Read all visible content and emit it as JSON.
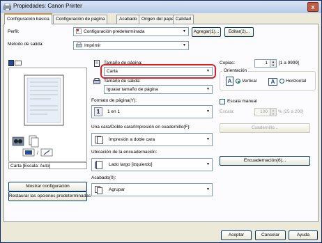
{
  "window": {
    "title": "Propiedades: Canon Printer",
    "close_glyph": "x"
  },
  "tabs": [
    {
      "label": "Configuración básica"
    },
    {
      "label": "Configuración de página"
    },
    {
      "label": "Acabado"
    },
    {
      "label": "Origen del papel"
    },
    {
      "label": "Calidad"
    }
  ],
  "profile": {
    "label": "Perfil:",
    "value": "Configuración predeterminada",
    "add_button": "Agregar(1)...",
    "edit_button": "Editar(2)..."
  },
  "output": {
    "label": "Método de salida:",
    "value": "Imprimir"
  },
  "page_size": {
    "label": "Tamaño de página:",
    "value": "Carta"
  },
  "output_size": {
    "label": "Tamaño de salida:",
    "value": "Igualar tamaño de página"
  },
  "copies": {
    "label": "Copias:",
    "value": "1",
    "range": "[1 a 9999]"
  },
  "orientation": {
    "label": "Orientación",
    "options": [
      {
        "glyph": "A",
        "label": "Vertical",
        "selected": true
      },
      {
        "glyph": "A",
        "label": "Horizontal",
        "selected": false
      }
    ]
  },
  "page_format": {
    "label": "Formato de página(Y):",
    "glyph": "1",
    "value": "1 en 1"
  },
  "manual_scale": {
    "label": "Escala manual",
    "scale_label": "Escala:",
    "scale_value": "100",
    "scale_range": "% [25 a 200]"
  },
  "duplex": {
    "label": "Una cara/Doble cara/Impresión en cuadernillo(F):",
    "value": "Impresión a doble cara",
    "booklet_button": "Cuadernillo..."
  },
  "binding": {
    "label": "Ubicación de la encuadernación:",
    "value": "Lado largo [izquierdo]",
    "binding_button": "Encuadernación(6)..."
  },
  "finishing": {
    "label": "Acabado(0):",
    "value": "Agrupar"
  },
  "preview": {
    "caption": "Carta [Escala: Auto]"
  },
  "left_buttons": {
    "show_config": "Mostrar configuración",
    "restore_defaults": "Restaurar las opciones predeterminadas"
  },
  "footer": {
    "ok": "Aceptar",
    "cancel": "Cancelar",
    "help": "Ayuda"
  },
  "colors": {
    "highlight": "#e02020",
    "tab_accent": "#e68b2c"
  }
}
